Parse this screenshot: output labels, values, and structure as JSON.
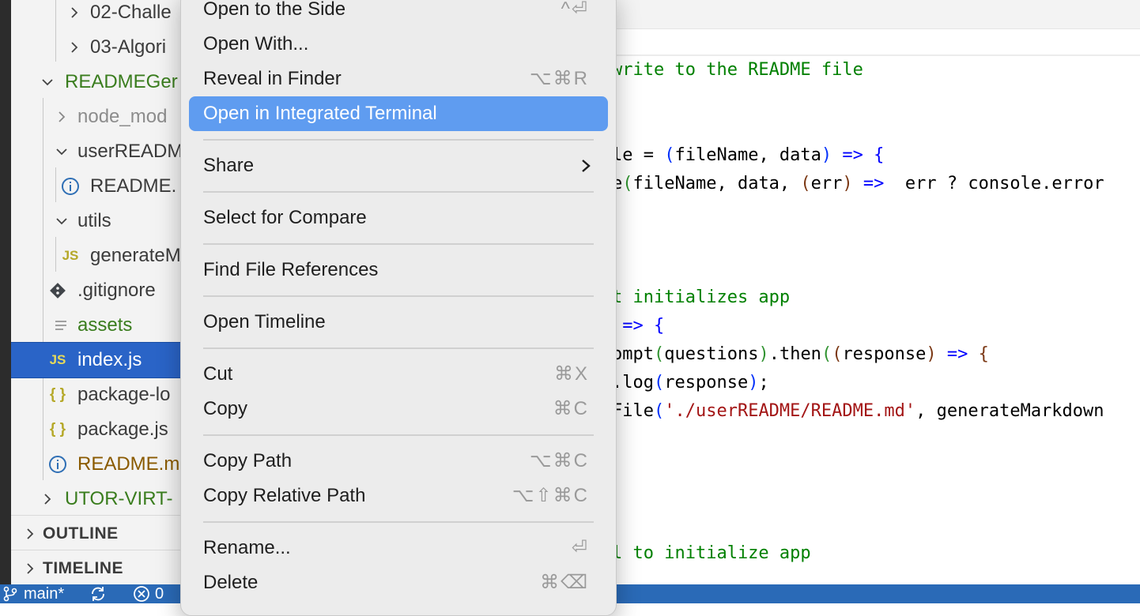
{
  "sidebar": {
    "tree": [
      {
        "label": "02-Challe",
        "kind": "folder-collapsed"
      },
      {
        "label": "03-Algori",
        "kind": "folder-collapsed"
      },
      {
        "label": "READMEGer",
        "kind": "folder-expanded"
      },
      {
        "label": "node_mod",
        "kind": "folder-collapsed"
      },
      {
        "label": "userREADM",
        "kind": "folder-expanded"
      },
      {
        "label": "README.",
        "kind": "file",
        "icon": "info-icon"
      },
      {
        "label": "utils",
        "kind": "folder-expanded"
      },
      {
        "label": "generateM",
        "kind": "file",
        "icon": "js-icon",
        "icon_text": "JS"
      },
      {
        "label": ".gitignore",
        "kind": "file",
        "icon": "git-icon"
      },
      {
        "label": "assets",
        "kind": "file",
        "icon": "lines-icon"
      },
      {
        "label": "index.js",
        "kind": "file",
        "icon": "js-icon",
        "icon_text": "JS",
        "selected": true
      },
      {
        "label": "package-lo",
        "kind": "file",
        "icon": "json-icon",
        "icon_text": "{ }"
      },
      {
        "label": "package.js",
        "kind": "file",
        "icon": "json-icon",
        "icon_text": "{ }"
      },
      {
        "label": "README.m",
        "kind": "file",
        "icon": "info-icon"
      },
      {
        "label": "UTOR-VIRT-",
        "kind": "folder-collapsed"
      }
    ],
    "sections": [
      {
        "label": "OUTLINE"
      },
      {
        "label": "TIMELINE"
      }
    ]
  },
  "editor": {
    "lines": [
      "write to the README file",
      "le = (fileName, data) => {",
      "e(fileName, data, (err) =>  err ? console.error",
      "t initializes app",
      " => {",
      "ompt(questions).then((response) => {",
      ".log(response);",
      "File('./userREADME/README.md', generateMarkdown",
      "l to initialize app"
    ]
  },
  "status_bar": {
    "branch": "main*",
    "errors": "0"
  },
  "context_menu": {
    "items": [
      {
        "label": "Open to the Side",
        "shortcut": "^⏎"
      },
      {
        "label": "Open With...",
        "shortcut": ""
      },
      {
        "label": "Reveal in Finder",
        "shortcut": "⌥⌘R"
      },
      {
        "label": "Open in Integrated Terminal",
        "shortcut": "",
        "highlighted": true
      },
      {
        "label": "Share",
        "shortcut": "",
        "submenu": true
      },
      {
        "label": "Select for Compare",
        "shortcut": ""
      },
      {
        "label": "Find File References",
        "shortcut": ""
      },
      {
        "label": "Open Timeline",
        "shortcut": ""
      },
      {
        "label": "Cut",
        "shortcut": "⌘X"
      },
      {
        "label": "Copy",
        "shortcut": "⌘C"
      },
      {
        "label": "Copy Path",
        "shortcut": "⌥⌘C"
      },
      {
        "label": "Copy Relative Path",
        "shortcut": "⌥⇧⌘C"
      },
      {
        "label": "Rename...",
        "shortcut": "⏎"
      },
      {
        "label": "Delete",
        "shortcut": "⌘⌫"
      }
    ]
  },
  "colors": {
    "selection": "#2a64c7",
    "menu_highlight": "#5f9cf0",
    "status_bar": "#2a6ab7",
    "comment": "#008000",
    "keyword": "#0000ff",
    "string": "#a31515",
    "folder_green": "#3a7d1e",
    "readme_brown": "#8a5a00",
    "js_icon": "#b5a828",
    "info_icon": "#2f6fb5"
  }
}
